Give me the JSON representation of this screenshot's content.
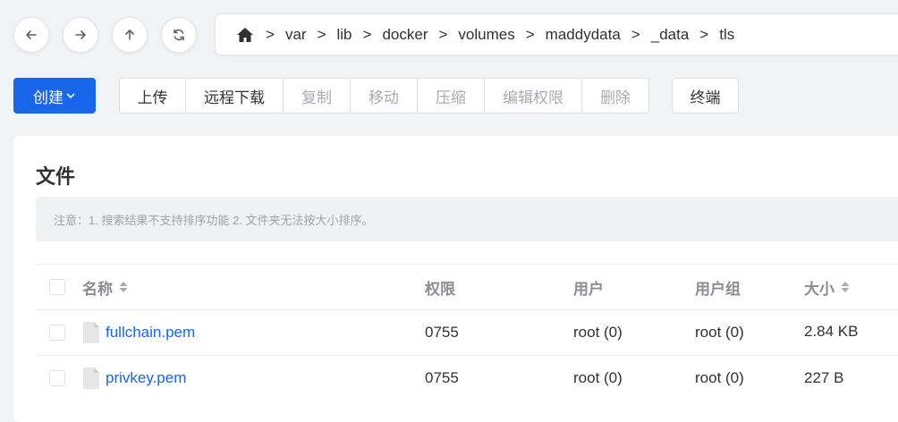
{
  "nav": {
    "back_icon": "arrow-left-icon",
    "forward_icon": "arrow-right-icon",
    "up_icon": "arrow-up-icon",
    "refresh_icon": "refresh-icon"
  },
  "path": {
    "home_icon": "home-icon",
    "separator": ">",
    "crumbs": [
      "var",
      "lib",
      "docker",
      "volumes",
      "maddydata",
      "_data",
      "tls"
    ]
  },
  "toolbar": {
    "create_label": "创建",
    "upload_label": "上传",
    "remote_download_label": "远程下载",
    "copy_label": "复制",
    "move_label": "移动",
    "compress_label": "压缩",
    "edit_perm_label": "编辑权限",
    "delete_label": "删除",
    "terminal_label": "终端"
  },
  "section": {
    "title": "文件",
    "notice": "注意：1. 搜索结果不支持排序功能 2. 文件夹无法按大小排序。"
  },
  "table": {
    "headers": {
      "name": "名称",
      "permission": "权限",
      "user": "用户",
      "group": "用户组",
      "size": "大小"
    },
    "rows": [
      {
        "name": "fullchain.pem",
        "permission": "0755",
        "user": "root (0)",
        "group": "root (0)",
        "size": "2.84 KB"
      },
      {
        "name": "privkey.pem",
        "permission": "0755",
        "user": "root (0)",
        "group": "root (0)",
        "size": "227 B"
      }
    ]
  },
  "colors": {
    "primary": "#1867ea",
    "background": "#f2f3f5",
    "disabled_text": "#a8abb2"
  }
}
